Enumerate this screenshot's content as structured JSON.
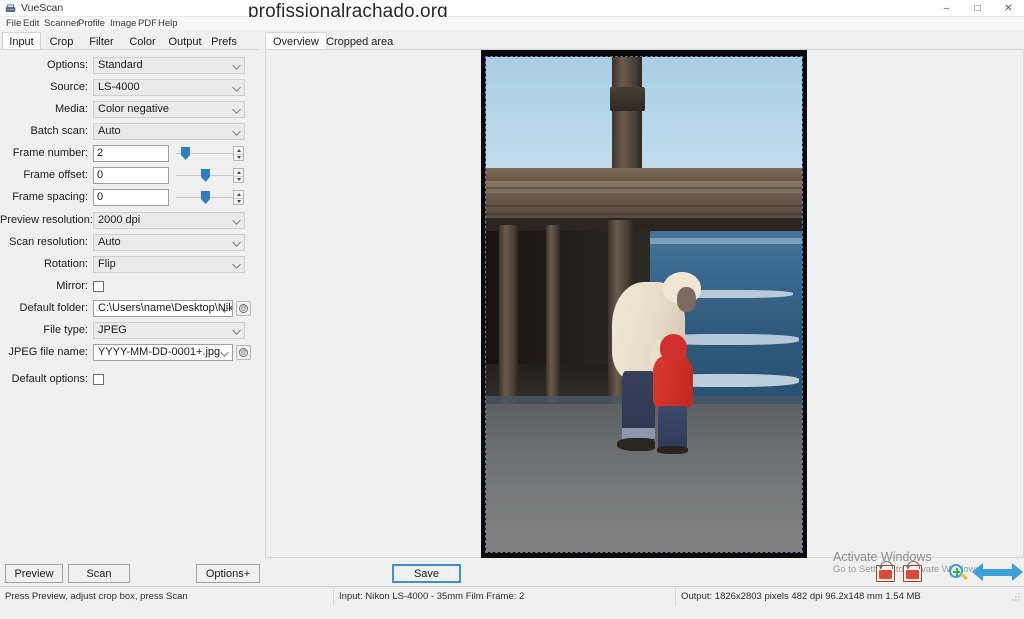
{
  "window": {
    "app_name": "VueScan",
    "app_icon": "scanner-icon",
    "page_title_overlay": "profissionalrachado.org",
    "minimize_label": "–",
    "maximize_label": "□",
    "close_label": "✕"
  },
  "menubar": {
    "items": [
      {
        "label": "File"
      },
      {
        "label": "Edit"
      },
      {
        "label": "Scanner"
      },
      {
        "label": "Profile"
      },
      {
        "label": "Image"
      },
      {
        "label": "PDF"
      },
      {
        "label": "Help"
      }
    ]
  },
  "left_tabs": [
    {
      "label": "Input",
      "active": true
    },
    {
      "label": "Crop",
      "active": false
    },
    {
      "label": "Filter",
      "active": false
    },
    {
      "label": "Color",
      "active": false
    },
    {
      "label": "Output",
      "active": false
    },
    {
      "label": "Prefs",
      "active": false
    }
  ],
  "input_panel": {
    "options": {
      "label": "Options:",
      "value": "Standard"
    },
    "source": {
      "label": "Source:",
      "value": "LS-4000"
    },
    "media": {
      "label": "Media:",
      "value": "Color negative"
    },
    "batch_scan": {
      "label": "Batch scan:",
      "value": "Auto"
    },
    "frame_number": {
      "label": "Frame number:",
      "value": "2"
    },
    "frame_offset": {
      "label": "Frame offset:",
      "value": "0"
    },
    "frame_spacing": {
      "label": "Frame spacing:",
      "value": "0"
    },
    "preview_resolution": {
      "label": "Preview resolution:",
      "value": "2000 dpi"
    },
    "scan_resolution": {
      "label": "Scan resolution:",
      "value": "Auto"
    },
    "rotation": {
      "label": "Rotation:",
      "value": "Flip"
    },
    "mirror": {
      "label": "Mirror:",
      "checked": false
    },
    "default_folder": {
      "label": "Default folder:",
      "value": "C:\\Users\\name\\Desktop\\Nikc"
    },
    "file_type": {
      "label": "File type:",
      "value": "JPEG"
    },
    "jpeg_file_name": {
      "label": "JPEG file name:",
      "value": "YYYY-MM-DD-0001+.jpg"
    },
    "default_options": {
      "label": "Default options:",
      "checked": false
    },
    "browse_icon": "at-browse-icon"
  },
  "preview_tabs": [
    {
      "label": "Overview",
      "active": true
    },
    {
      "label": "Cropped area",
      "active": false
    }
  ],
  "preview": {
    "image_description": "Scanned 35mm film frame: adult in cream hooded parka bending toward a toddler in a red jacket on a grey sand beach beneath a weathered wooden pier, ocean waves behind",
    "crop_selection": "marching-ants-crop-box"
  },
  "buttons": {
    "preview": "Preview",
    "scan": "Scan",
    "options_plus": "Options+",
    "save": "Save"
  },
  "statusbar": {
    "hint": "Press Preview, adjust crop box, press Scan",
    "input": "Input: Nikon LS-4000 - 35mm Film Frame: 2",
    "output": "Output: 1826x2803 pixels 482 dpi 96.2x148 mm 1.54 MB"
  },
  "watermark": {
    "title": "Activate Windows",
    "subtitle": "Go to Settings to activate Windows"
  },
  "overlay_tools": [
    {
      "name": "rotate-left-icon"
    },
    {
      "name": "rotate-right-icon"
    },
    {
      "name": "zoom-in-icon"
    },
    {
      "name": "previous-arrow-icon"
    },
    {
      "name": "next-arrow-icon"
    }
  ],
  "colors": {
    "accent": "#2e7ec4",
    "focus": "#3f8fd0",
    "panel_bg": "#f0f0f0",
    "field_bg": "#eaeaea"
  }
}
